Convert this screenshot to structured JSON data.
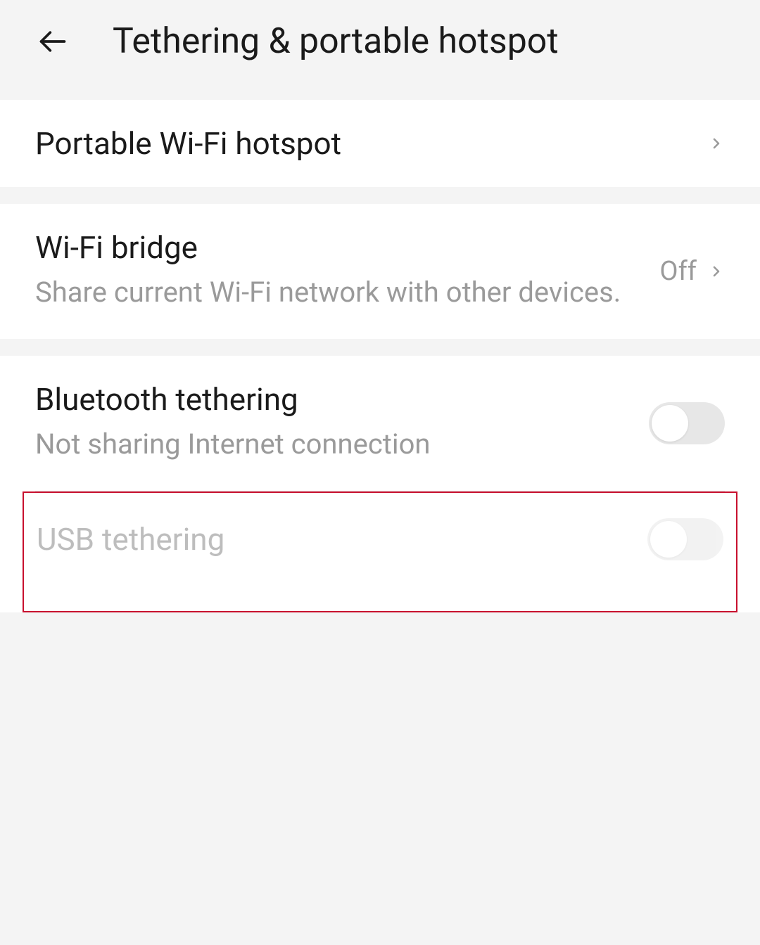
{
  "header": {
    "title": "Tethering & portable hotspot"
  },
  "settings": {
    "portable_hotspot": {
      "title": "Portable Wi-Fi hotspot"
    },
    "wifi_bridge": {
      "title": "Wi-Fi bridge",
      "subtitle": "Share current Wi-Fi network with other devices.",
      "value": "Off"
    },
    "bluetooth_tethering": {
      "title": "Bluetooth tethering",
      "subtitle": "Not sharing Internet connection"
    },
    "usb_tethering": {
      "title": "USB tethering"
    }
  }
}
